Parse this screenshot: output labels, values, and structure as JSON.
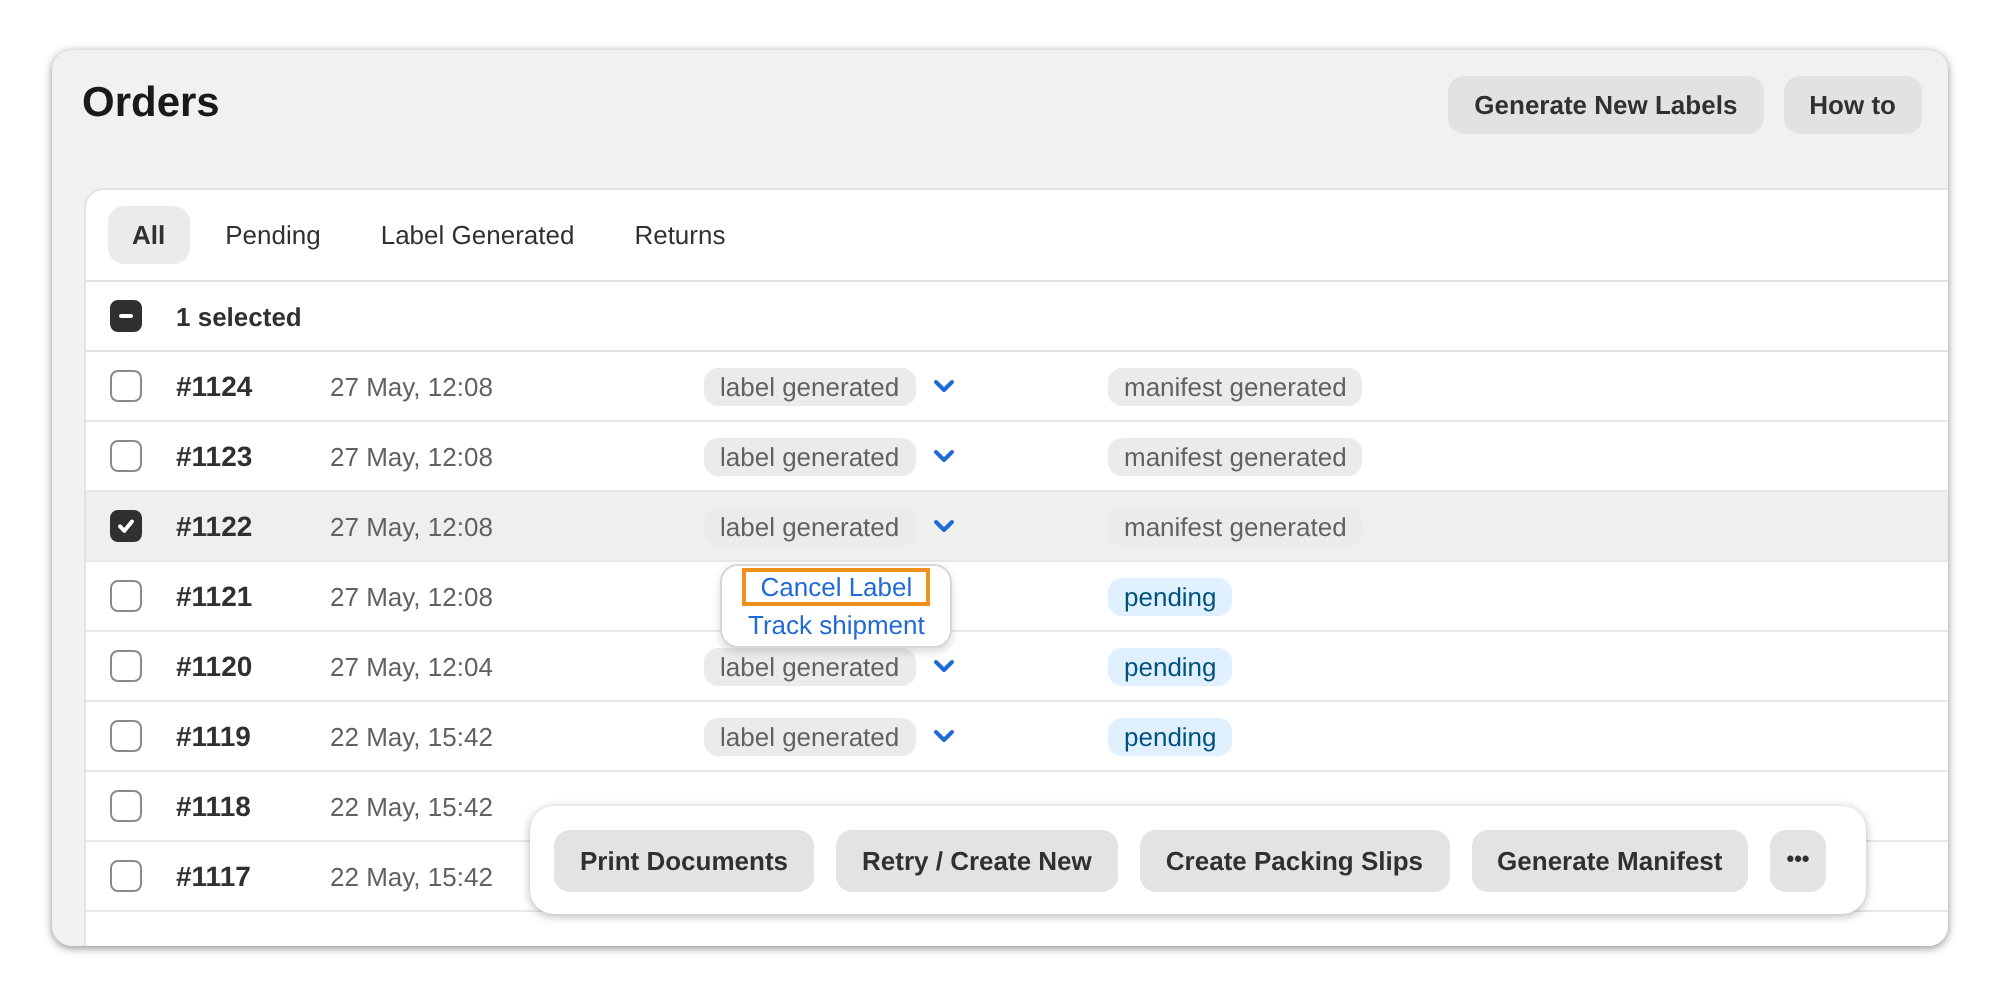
{
  "page": {
    "title": "Orders"
  },
  "header_buttons": [
    "Generate New Labels",
    "How to"
  ],
  "tabs": [
    {
      "label": "All",
      "selected": true
    },
    {
      "label": "Pending",
      "selected": false
    },
    {
      "label": "Label Generated",
      "selected": false
    },
    {
      "label": "Returns",
      "selected": false
    }
  ],
  "bulk": {
    "checked": true,
    "mixed": true,
    "label": "1 selected"
  },
  "rows": [
    {
      "order": "#1124",
      "date": "27 May, 12:08",
      "label_status": "label generated",
      "status": "manifest generated",
      "kind": "neutral",
      "selected": false
    },
    {
      "order": "#1123",
      "date": "27 May, 12:08",
      "label_status": "label generated",
      "status": "manifest generated",
      "kind": "neutral",
      "selected": false
    },
    {
      "order": "#1122",
      "date": "27 May, 12:08",
      "label_status": "label generated",
      "status": "manifest generated",
      "kind": "neutral",
      "selected": true
    },
    {
      "order": "#1121",
      "date": "27 May, 12:08",
      "status": "pending",
      "kind": "info",
      "selected": false
    },
    {
      "order": "#1120",
      "date": "27 May, 12:04",
      "label_status": "label generated",
      "status": "pending",
      "kind": "info",
      "selected": false
    },
    {
      "order": "#1119",
      "date": "22 May, 15:42",
      "label_status": "label generated",
      "status": "pending",
      "kind": "info",
      "selected": false
    },
    {
      "order": "#1118",
      "date": "22 May, 15:42",
      "selected": false
    },
    {
      "order": "#1117",
      "date": "22 May, 15:42",
      "selected": false
    }
  ],
  "popover_menu": [
    {
      "label": "Cancel Label",
      "selected": true
    },
    {
      "label": "Track shipment",
      "selected": false
    }
  ],
  "action_bar": {
    "buttons": [
      "Print Documents",
      "Retry / Create New",
      "Create Packing Slips",
      "Generate Manifest"
    ],
    "more": "•••"
  }
}
